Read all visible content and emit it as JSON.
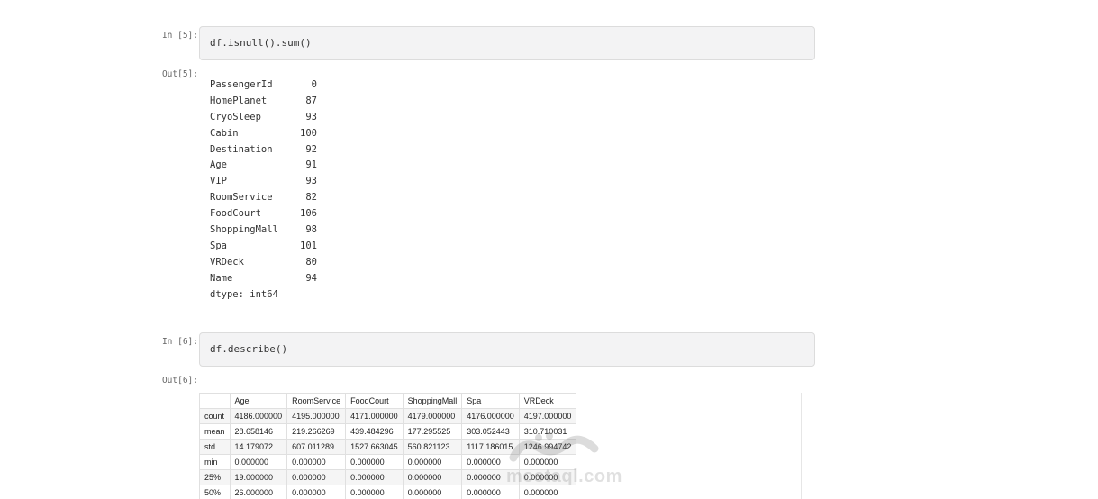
{
  "cells": {
    "in5_prompt": "In [5]:",
    "in5_code": "df.isnull().sum()",
    "out5_prompt": "Out[5]:",
    "in6_prompt": "In [6]:",
    "in6_code": "df.describe()",
    "out6_prompt": "Out[6]:"
  },
  "isnull_series": [
    {
      "name": "PassengerId",
      "value": "0"
    },
    {
      "name": "HomePlanet",
      "value": "87"
    },
    {
      "name": "CryoSleep",
      "value": "93"
    },
    {
      "name": "Cabin",
      "value": "100"
    },
    {
      "name": "Destination",
      "value": "92"
    },
    {
      "name": "Age",
      "value": "91"
    },
    {
      "name": "VIP",
      "value": "93"
    },
    {
      "name": "RoomService",
      "value": "82"
    },
    {
      "name": "FoodCourt",
      "value": "106"
    },
    {
      "name": "ShoppingMall",
      "value": "98"
    },
    {
      "name": "Spa",
      "value": "101"
    },
    {
      "name": "VRDeck",
      "value": "80"
    },
    {
      "name": "Name",
      "value": "94"
    }
  ],
  "isnull_dtype": "dtype: int64",
  "describe_table": {
    "columns": [
      "",
      "Age",
      "RoomService",
      "FoodCourt",
      "ShoppingMall",
      "Spa",
      "VRDeck"
    ],
    "rows": [
      [
        "count",
        "4186.000000",
        "4195.000000",
        "4171.000000",
        "4179.000000",
        "4176.000000",
        "4197.000000"
      ],
      [
        "mean",
        "28.658146",
        "219.266269",
        "439.484296",
        "177.295525",
        "303.052443",
        "310.710031"
      ],
      [
        "std",
        "14.179072",
        "607.011289",
        "1527.663045",
        "560.821123",
        "1117.186015",
        "1246.994742"
      ],
      [
        "min",
        "0.000000",
        "0.000000",
        "0.000000",
        "0.000000",
        "0.000000",
        "0.000000"
      ],
      [
        "25%",
        "19.000000",
        "0.000000",
        "0.000000",
        "0.000000",
        "0.000000",
        "0.000000"
      ],
      [
        "50%",
        "26.000000",
        "0.000000",
        "0.000000",
        "0.000000",
        "0.000000",
        "0.000000"
      ]
    ]
  },
  "watermark": {
    "text": "mostaql.com"
  }
}
